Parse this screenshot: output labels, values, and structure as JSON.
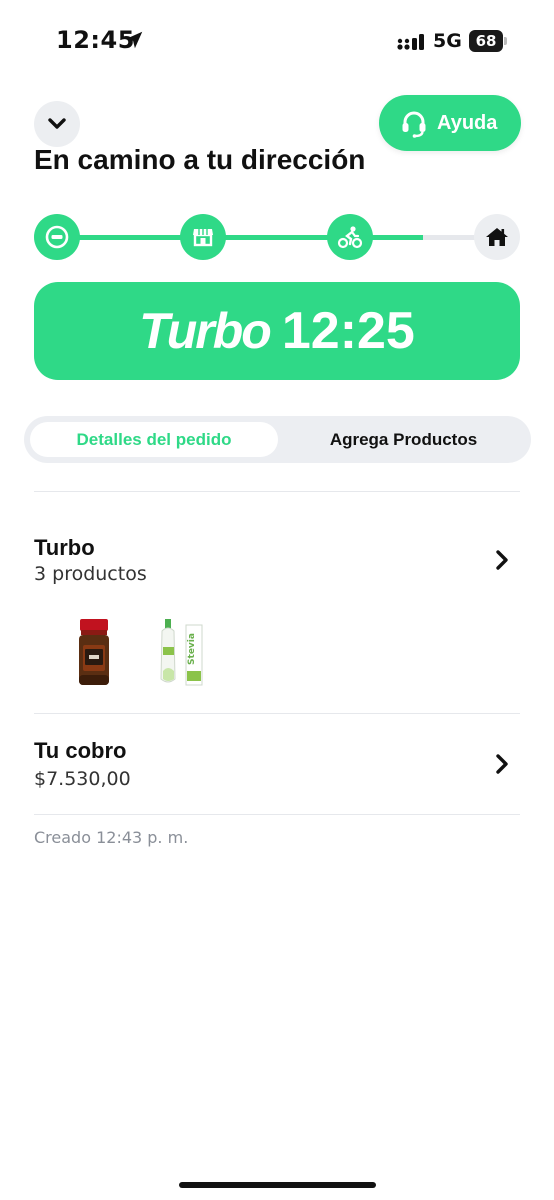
{
  "status_bar": {
    "time": "12:45",
    "network": "5G",
    "battery": "68"
  },
  "header": {
    "collapse_icon": "chevron-down-icon",
    "help_label": "Ayuda",
    "help_icon": "headset-icon",
    "title": "En camino a tu dirección"
  },
  "tracker": {
    "steps": [
      {
        "icon": "order-received-icon",
        "state": "done"
      },
      {
        "icon": "store-icon",
        "state": "done"
      },
      {
        "icon": "courier-bike-icon",
        "state": "done"
      },
      {
        "icon": "home-icon",
        "state": "pending"
      }
    ],
    "progress": 0.83
  },
  "eta": {
    "brand": "Turbo",
    "time": "12:25"
  },
  "tabs": {
    "details": "Detalles del pedido",
    "add_products": "Agrega Productos"
  },
  "order": {
    "title": "Turbo",
    "count": "3 productos"
  },
  "payment": {
    "title": "Tu cobro",
    "amount": "$7.530,00"
  },
  "created": "Creado 12:43 p. m.",
  "products": [
    {
      "name": "coffee-jar-image",
      "label": ""
    },
    {
      "name": "stevia-bottle-image",
      "label": "Stevia"
    }
  ],
  "colors": {
    "accent": "#2fd987",
    "text": "#111111",
    "muted": "#8a8f98",
    "surface": "#eceef2"
  }
}
